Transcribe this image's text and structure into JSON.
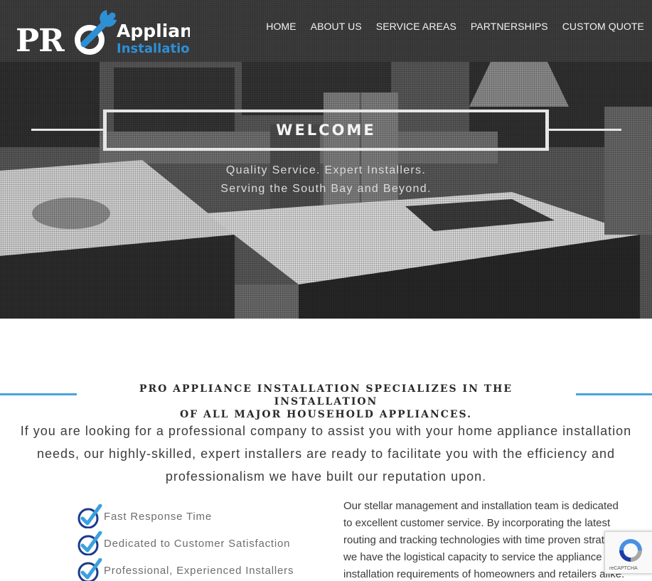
{
  "brand": {
    "logo_word1": "PRO",
    "logo_word2": "Appliance",
    "logo_word3": "Installation",
    "colors": {
      "accent": "#4aa3d8",
      "logo_blue": "#2e8fd4",
      "text": "#3c3c3c"
    }
  },
  "nav": {
    "items": [
      {
        "label": "HOME"
      },
      {
        "label": "ABOUT US"
      },
      {
        "label": "SERVICE AREAS"
      },
      {
        "label": "PARTNERSHIPS"
      },
      {
        "label": "CUSTOM QUOTE"
      }
    ]
  },
  "hero": {
    "title": "WELCOME",
    "tagline1": "Quality Service. Expert Installers.",
    "tagline2": "Serving the South Bay and Beyond."
  },
  "section": {
    "title_line1": "PRO APPLIANCE INSTALLATION SPECIALIZES IN THE INSTALLATION",
    "title_line2": "OF ALL MAJOR HOUSEHOLD APPLIANCES.",
    "intro_line1": "If you are looking for a professional company to assist you with your home appliance installation",
    "intro_line2": "needs, our highly-skilled, expert installers are ready to facilitate you with the efficiency and",
    "intro_line3": "professionalism we have built our reputation upon.",
    "checklist": [
      {
        "label": "Fast Response Time"
      },
      {
        "label": "Dedicated to Customer Satisfaction"
      },
      {
        "label": "Professional, Experienced Installers"
      }
    ],
    "para_line1": "Our stellar management and installation team is dedicated",
    "para_line2": "to excellent customer service. By incorporating the latest",
    "para_line3": "routing and tracking technologies with time proven strat",
    "para_line4": "we have the logistical capacity to service the appliance",
    "para_line5": "installation requirements of homeowners and retailers alike."
  },
  "recaptcha": {
    "label": "reCAPTCHA",
    "icon": "recaptcha-icon"
  }
}
